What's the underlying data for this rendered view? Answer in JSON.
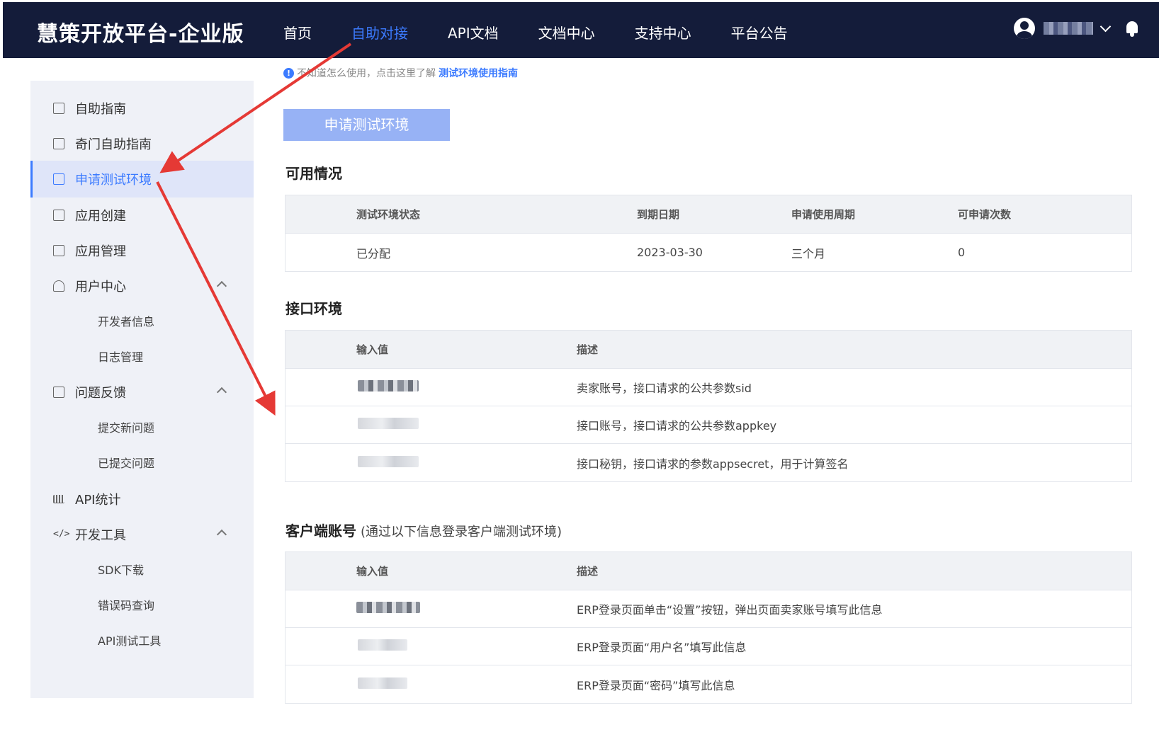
{
  "header": {
    "brand": "慧策开放平台-企业版",
    "nav": [
      {
        "label": "首页",
        "active": false
      },
      {
        "label": "自助对接",
        "active": true
      },
      {
        "label": "API文档",
        "active": false
      },
      {
        "label": "文档中心",
        "active": false
      },
      {
        "label": "支持中心",
        "active": false
      },
      {
        "label": "平台公告",
        "active": false
      }
    ],
    "icons": [
      "user-avatar-icon",
      "chevron-down-icon",
      "bell-icon"
    ]
  },
  "sidebar": {
    "items": [
      {
        "label": "自助指南",
        "icon": "guide-icon"
      },
      {
        "label": "奇门自助指南",
        "icon": "guide-icon"
      },
      {
        "label": "申请测试环境",
        "icon": "monitor-icon",
        "active": true
      },
      {
        "label": "应用创建",
        "icon": "app-create-icon"
      },
      {
        "label": "应用管理",
        "icon": "app-manage-icon"
      },
      {
        "label": "用户中心",
        "icon": "user-icon",
        "expanded": true
      },
      {
        "label": "开发者信息",
        "sub": true
      },
      {
        "label": "日志管理",
        "sub": true
      },
      {
        "label": "问题反馈",
        "icon": "feedback-icon",
        "expanded": true
      },
      {
        "label": "提交新问题",
        "sub": true
      },
      {
        "label": "已提交问题",
        "sub": true
      },
      {
        "label": "API统计",
        "icon": "bar-chart-icon"
      },
      {
        "label": "开发工具",
        "icon": "code-icon",
        "expanded": true
      },
      {
        "label": "SDK下载",
        "sub": true
      },
      {
        "label": "错误码查询",
        "sub": true
      },
      {
        "label": "API测试工具",
        "sub": true
      }
    ]
  },
  "main": {
    "tip_text": "不知道怎么使用，点击这里了解",
    "tip_link": "测试环境使用指南",
    "apply_button": "申请测试环境",
    "availability": {
      "title": "可用情况",
      "headers": [
        "测试环境状态",
        "到期日期",
        "申请使用周期",
        "可申请次数"
      ],
      "row": [
        "已分配",
        "2023-03-30",
        "三个月",
        "0"
      ]
    },
    "interface_env": {
      "title": "接口环境",
      "headers": [
        "输入值",
        "描述"
      ],
      "rows": [
        {
          "desc": "卖家账号，接口请求的公共参数sid"
        },
        {
          "desc": "接口账号，接口请求的公共参数appkey"
        },
        {
          "desc": "接口秘钥，接口请求的参数appsecret，用于计算签名"
        }
      ]
    },
    "client_account": {
      "title": "客户端账号",
      "note": "(通过以下信息登录客户端测试环境)",
      "headers": [
        "输入值",
        "描述"
      ],
      "rows": [
        {
          "desc": "ERP登录页面单击“设置”按钮，弹出页面卖家账号填写此信息"
        },
        {
          "desc": "ERP登录页面“用户名”填写此信息"
        },
        {
          "desc": "ERP登录页面“密码”填写此信息"
        }
      ]
    }
  },
  "colors": {
    "topbar": "#141c3a",
    "accent": "#3c7bff",
    "button": "#97b2f5",
    "sidebar_bg": "#eff1f7",
    "arrow": "#e53935"
  }
}
